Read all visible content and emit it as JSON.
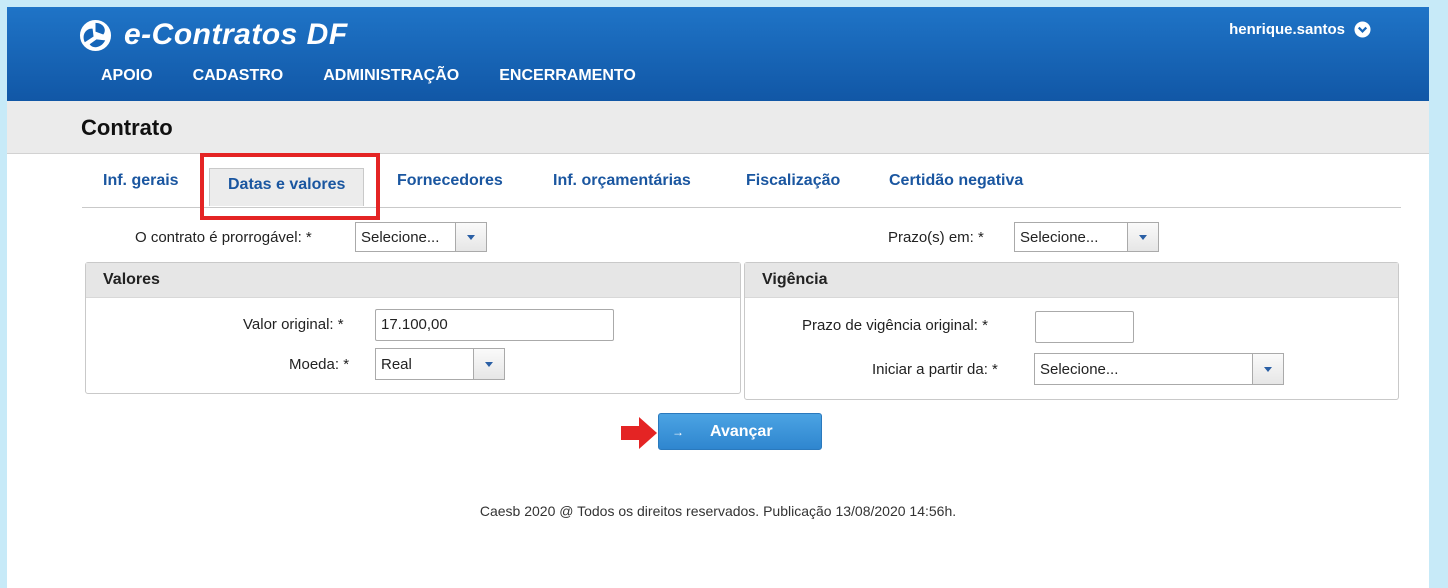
{
  "header": {
    "app_title": "e-Contratos DF",
    "user_name": "henrique.santos",
    "menu": [
      "APOIO",
      "CADASTRO",
      "ADMINISTRAÇÃO",
      "ENCERRAMENTO"
    ]
  },
  "page": {
    "title": "Contrato"
  },
  "tabs": [
    {
      "label": "Inf. gerais"
    },
    {
      "label": "Datas e valores",
      "active": true
    },
    {
      "label": "Fornecedores"
    },
    {
      "label": "Inf. orçamentárias"
    },
    {
      "label": "Fiscalização"
    },
    {
      "label": "Certidão negativa"
    }
  ],
  "form": {
    "prorrogavel_label": "O contrato é prorrogável: *",
    "prorrogavel_value": "Selecione...",
    "prazo_em_label": "Prazo(s) em: *",
    "prazo_em_value": "Selecione..."
  },
  "valores": {
    "title": "Valores",
    "valor_original_label": "Valor original: *",
    "valor_original_value": "17.100,00",
    "moeda_label": "Moeda: *",
    "moeda_value": "Real"
  },
  "vigencia": {
    "title": "Vigência",
    "prazo_label": "Prazo de vigência original: *",
    "prazo_value": "",
    "iniciar_label": "Iniciar a partir da: *",
    "iniciar_value": "Selecione..."
  },
  "actions": {
    "avancar_label": "Avançar"
  },
  "footer": {
    "text": "Caesb 2020 @ Todos os direitos reservados. Publicação 13/08/2020 14:56h."
  },
  "colors": {
    "header_blue": "#1565b8",
    "highlight_red": "#e42424",
    "button_blue": "#3b92d8"
  }
}
